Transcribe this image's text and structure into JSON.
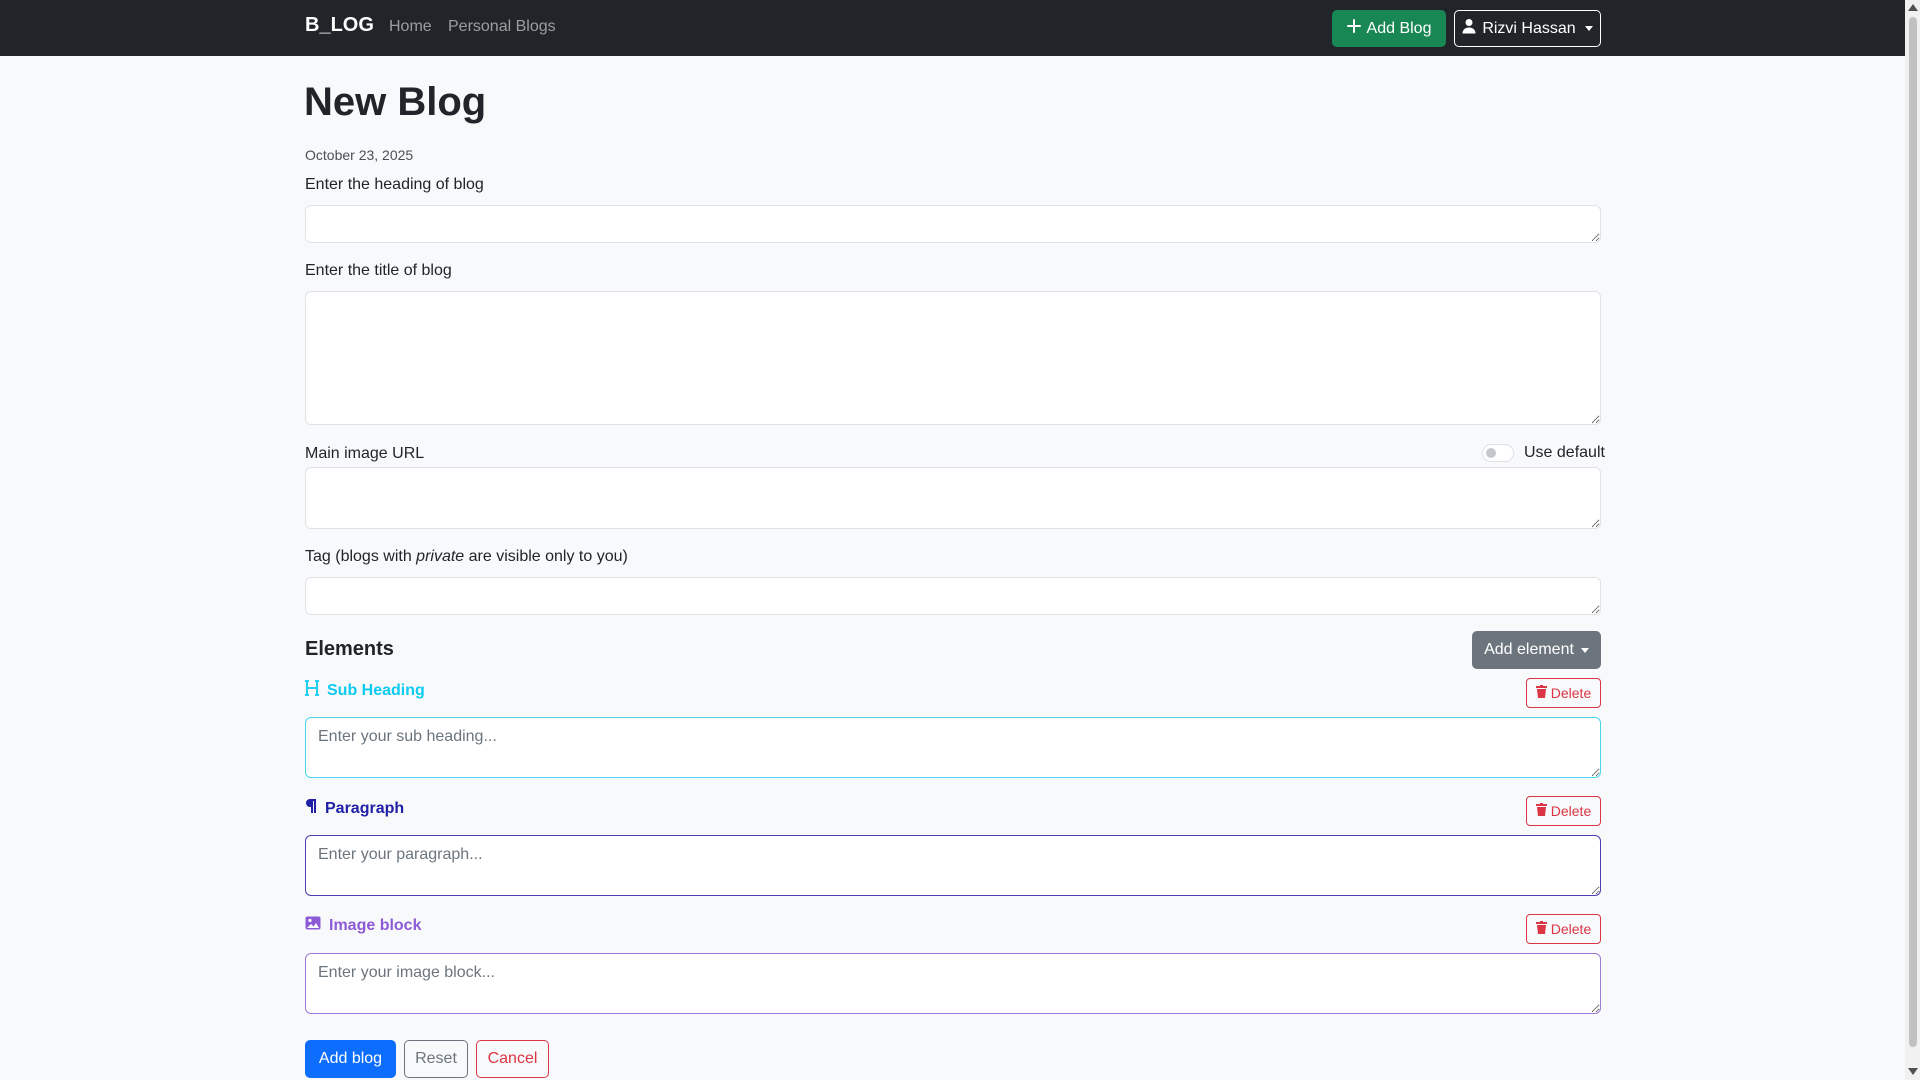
{
  "navbar": {
    "brand": "B_LOG",
    "links": [
      "Home",
      "Personal Blogs"
    ],
    "add_blog_label": "Add Blog",
    "user_name": "Rizvi Hassan"
  },
  "page": {
    "title": "New Blog",
    "date": "October 23, 2025"
  },
  "form": {
    "heading_label": "Enter the heading of blog",
    "heading_value": "",
    "title_label": "Enter the title of blog",
    "title_value": "",
    "image_label": "Main image URL",
    "image_value": "",
    "use_default_label": "Use default",
    "use_default_checked": false,
    "tag_label_prefix": "Tag (blogs with ",
    "tag_label_em": "private",
    "tag_label_suffix": " are visible only to you)",
    "tag_value": ""
  },
  "elements": {
    "heading": "Elements",
    "add_element_label": "Add element",
    "delete_label": "Delete",
    "items": [
      {
        "label": "Sub Heading",
        "placeholder": "Enter your sub heading...",
        "color": "#0dcaf0",
        "icon": "heading-icon"
      },
      {
        "label": "Paragraph",
        "placeholder": "Enter your paragraph...",
        "color": "#1f1fa8",
        "icon": "pilcrow-icon"
      },
      {
        "label": "Image block",
        "placeholder": "Enter your image block...",
        "color": "#8e5bd8",
        "icon": "image-icon"
      }
    ]
  },
  "actions": {
    "submit_label": "Add blog",
    "reset_label": "Reset",
    "cancel_label": "Cancel"
  },
  "colors": {
    "navbar_bg": "#212529",
    "success": "#198754",
    "primary": "#0d6efd",
    "danger": "#dc3545",
    "secondary": "#6c757d"
  }
}
